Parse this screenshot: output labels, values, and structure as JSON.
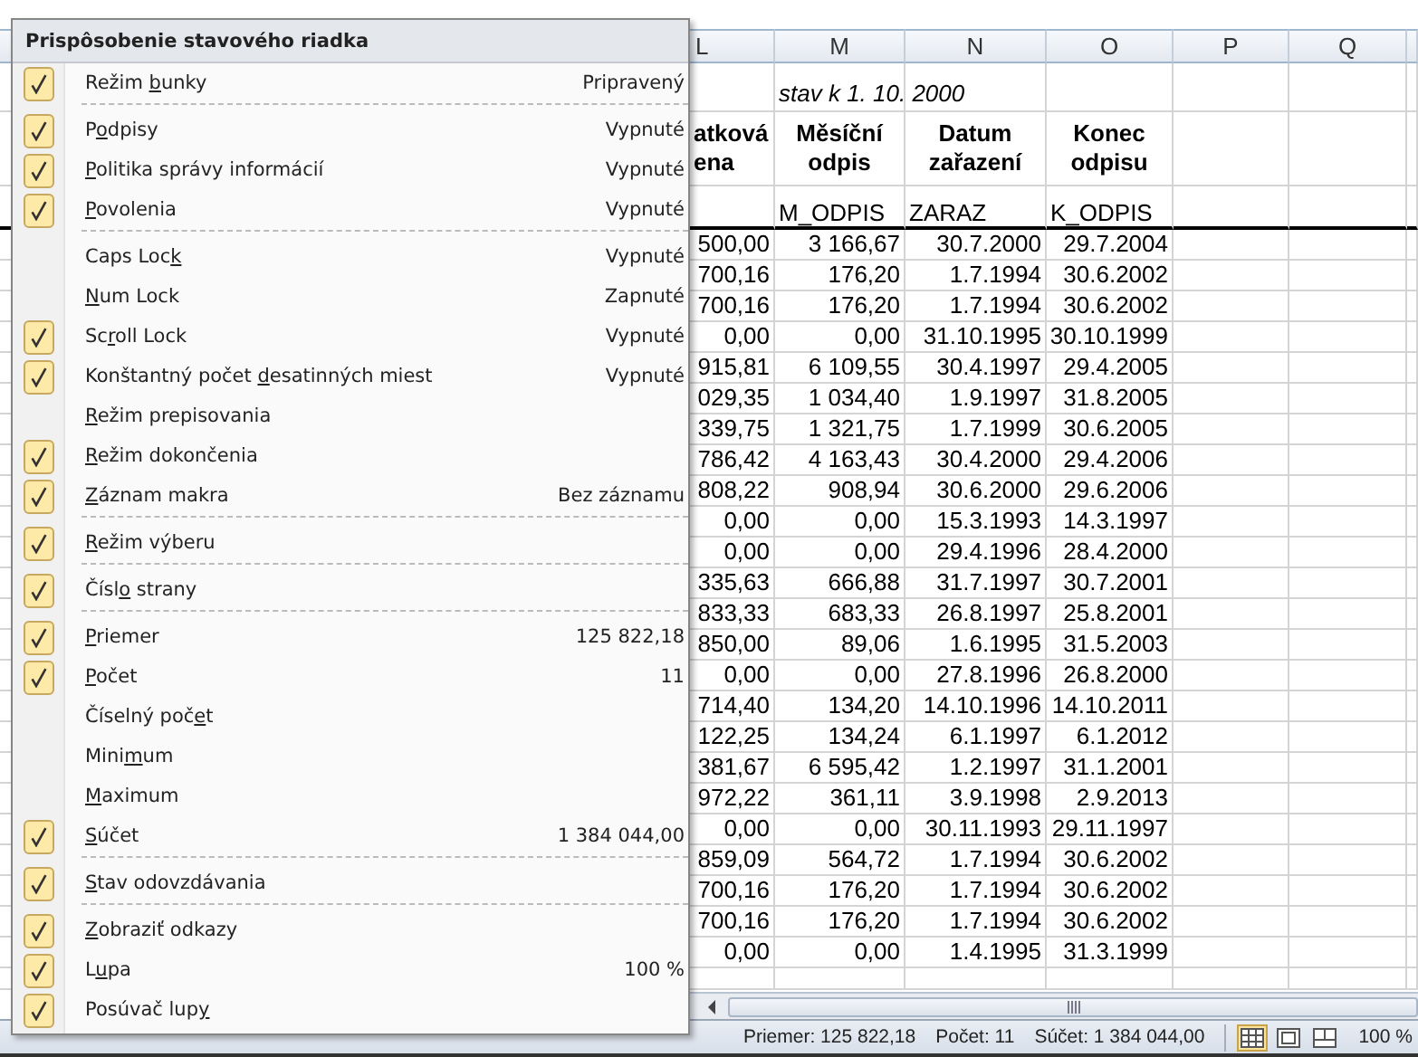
{
  "sheet": {
    "column_headers": [
      "L",
      "M",
      "N",
      "O",
      "P",
      "Q"
    ],
    "note": "stav k 1. 10. 2000",
    "headers": [
      [
        "atková",
        "ena"
      ],
      [
        "Měsíční",
        "odpis"
      ],
      [
        "Datum",
        "zařazení"
      ],
      [
        "Konec",
        "odpisu"
      ]
    ],
    "field_names": [
      "M_ODPIS",
      "ZARAZ",
      "K_ODPIS"
    ],
    "rows": [
      [
        "500,00",
        "3 166,67",
        "30.7.2000",
        "29.7.2004"
      ],
      [
        "700,16",
        "176,20",
        "1.7.1994",
        "30.6.2002"
      ],
      [
        "700,16",
        "176,20",
        "1.7.1994",
        "30.6.2002"
      ],
      [
        "0,00",
        "0,00",
        "31.10.1995",
        "30.10.1999"
      ],
      [
        "915,81",
        "6 109,55",
        "30.4.1997",
        "29.4.2005"
      ],
      [
        "029,35",
        "1 034,40",
        "1.9.1997",
        "31.8.2005"
      ],
      [
        "339,75",
        "1 321,75",
        "1.7.1999",
        "30.6.2005"
      ],
      [
        "786,42",
        "4 163,43",
        "30.4.2000",
        "29.4.2006"
      ],
      [
        "808,22",
        "908,94",
        "30.6.2000",
        "29.6.2006"
      ],
      [
        "0,00",
        "0,00",
        "15.3.1993",
        "14.3.1997"
      ],
      [
        "0,00",
        "0,00",
        "29.4.1996",
        "28.4.2000"
      ],
      [
        "335,63",
        "666,88",
        "31.7.1997",
        "30.7.2001"
      ],
      [
        "833,33",
        "683,33",
        "26.8.1997",
        "25.8.2001"
      ],
      [
        "850,00",
        "89,06",
        "1.6.1995",
        "31.5.2003"
      ],
      [
        "0,00",
        "0,00",
        "27.8.1996",
        "26.8.2000"
      ],
      [
        "714,40",
        "134,20",
        "14.10.1996",
        "14.10.2011"
      ],
      [
        "122,25",
        "134,24",
        "6.1.1997",
        "6.1.2012"
      ],
      [
        "381,67",
        "6 595,42",
        "1.2.1997",
        "31.1.2001"
      ],
      [
        "972,22",
        "361,11",
        "3.9.1998",
        "2.9.2013"
      ],
      [
        "0,00",
        "0,00",
        "30.11.1993",
        "29.11.1997"
      ],
      [
        "859,09",
        "564,72",
        "1.7.1994",
        "30.6.2002"
      ],
      [
        "700,16",
        "176,20",
        "1.7.1994",
        "30.6.2002"
      ],
      [
        "700,16",
        "176,20",
        "1.7.1994",
        "30.6.2002"
      ],
      [
        "0,00",
        "0,00",
        "1.4.1995",
        "31.3.1999"
      ]
    ]
  },
  "menu": {
    "title": "Prispôsobenie stavového riadka",
    "items": [
      {
        "kind": "item",
        "label": {
          "before": "Režim ",
          "key": "b",
          "after": "unky"
        },
        "value": "Pripravený",
        "checked": true
      },
      {
        "kind": "separator"
      },
      {
        "kind": "item",
        "label": {
          "before": "P",
          "key": "o",
          "after": "dpisy"
        },
        "value": "Vypnuté",
        "checked": true
      },
      {
        "kind": "item",
        "label": {
          "key": "P",
          "after": "olitika správy informácií"
        },
        "value": "Vypnuté",
        "checked": true
      },
      {
        "kind": "item",
        "label": {
          "key": "P",
          "after": "ovolenia"
        },
        "value": "Vypnuté",
        "checked": true
      },
      {
        "kind": "separator"
      },
      {
        "kind": "item",
        "label": {
          "before": "Caps Loc",
          "key": "k"
        },
        "value": "Vypnuté",
        "checked": false
      },
      {
        "kind": "item",
        "label": {
          "key": "N",
          "after": "um Lock"
        },
        "value": "Zapnuté",
        "checked": false
      },
      {
        "kind": "item",
        "label": {
          "before": "Sc",
          "key": "r",
          "after": "oll Lock"
        },
        "value": "Vypnuté",
        "checked": true
      },
      {
        "kind": "item",
        "label": {
          "before": "Konštantný počet ",
          "key": "d",
          "after": "esatinných miest"
        },
        "value": "Vypnuté",
        "checked": true
      },
      {
        "kind": "item",
        "label": {
          "key": "R",
          "after": "ežim prepisovania"
        },
        "checked": false
      },
      {
        "kind": "item",
        "label": {
          "key": "R",
          "after": "ežim dokončenia"
        },
        "checked": true
      },
      {
        "kind": "item",
        "label": {
          "key": "Z",
          "after": "áznam makra"
        },
        "value": "Bez záznamu",
        "checked": true
      },
      {
        "kind": "separator"
      },
      {
        "kind": "item",
        "label": {
          "key": "R",
          "after": "ežim výberu"
        },
        "checked": true
      },
      {
        "kind": "separator"
      },
      {
        "kind": "item",
        "label": {
          "before": "Čísl",
          "key": "o",
          "after": " strany"
        },
        "checked": true
      },
      {
        "kind": "separator"
      },
      {
        "kind": "item",
        "label": {
          "key": "P",
          "after": "riemer"
        },
        "value": "125 822,18",
        "checked": true
      },
      {
        "kind": "item",
        "label": {
          "key": "P",
          "after": "očet"
        },
        "value": "11",
        "checked": true
      },
      {
        "kind": "item",
        "label": {
          "before": "Číselný poč",
          "key": "e",
          "after": "t"
        },
        "checked": false
      },
      {
        "kind": "item",
        "label": {
          "before": "Mini",
          "key": "m",
          "after": "um"
        },
        "checked": false
      },
      {
        "kind": "item",
        "label": {
          "key": "M",
          "after": "aximum"
        },
        "checked": false
      },
      {
        "kind": "item",
        "label": {
          "key": "S",
          "after": "účet"
        },
        "value": "1 384 044,00",
        "checked": true
      },
      {
        "kind": "separator"
      },
      {
        "kind": "item",
        "label": {
          "key": "S",
          "after": "tav odovzdávania"
        },
        "checked": true
      },
      {
        "kind": "separator"
      },
      {
        "kind": "item",
        "label": {
          "key": "Z",
          "after": "obraziť odkazy"
        },
        "checked": true
      },
      {
        "kind": "item",
        "label": {
          "before": "L",
          "key": "u",
          "after": "pa"
        },
        "value": "100 %",
        "checked": true
      },
      {
        "kind": "item",
        "label": {
          "before": "Posúvač lup",
          "key": "y"
        },
        "checked": true
      }
    ]
  },
  "status_bar": {
    "stats": [
      "Priemer: 125 822,18",
      "Počet: 11",
      "Súčet: 1 384 044,00"
    ],
    "views": [
      {
        "kind": "normal",
        "selected": true
      },
      {
        "kind": "page-layout",
        "selected": false
      },
      {
        "kind": "page-break",
        "selected": false
      }
    ],
    "zoom": "100 %"
  }
}
